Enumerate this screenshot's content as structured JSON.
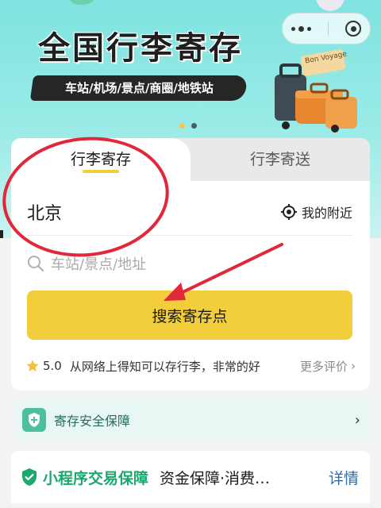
{
  "colors": {
    "hero_bg": "#8fe8e4",
    "accent_yellow": "#f2cd3c",
    "safe_green": "#4dbf9f",
    "guarantee_green": "#1aa86b",
    "link_blue": "#2a6fb0",
    "annotation_red": "#e0283a"
  },
  "hero": {
    "title": "全国行李寄存",
    "subtitle": "车站/机场/景点/商圈/地铁站",
    "luggage_tag": "Bon Voyage",
    "carousel_pages": 2,
    "carousel_active": 1
  },
  "capsule": {
    "more_icon": "more-dots-icon",
    "close_icon": "target-close-icon"
  },
  "tabs": [
    {
      "label": "行李寄存",
      "active": true
    },
    {
      "label": "行李寄送",
      "active": false
    }
  ],
  "location": {
    "city": "北京",
    "nearby_label": "我的附近",
    "nearby_icon": "locate-crosshair-icon"
  },
  "search": {
    "placeholder": "车站/景点/地址",
    "icon": "search-icon",
    "button_label": "搜索寄存点"
  },
  "rating": {
    "icon": "star-icon",
    "score": "5.0",
    "review": "从网络上得知可以存行李，非常的好",
    "more_label": "更多评价"
  },
  "safety": {
    "icon": "shield-plus-icon",
    "label": "寄存安全保障"
  },
  "guarantee": {
    "icon": "shield-check-icon",
    "title": "小程序交易保障",
    "description": "资金保障·消费…",
    "detail_label": "详情"
  }
}
